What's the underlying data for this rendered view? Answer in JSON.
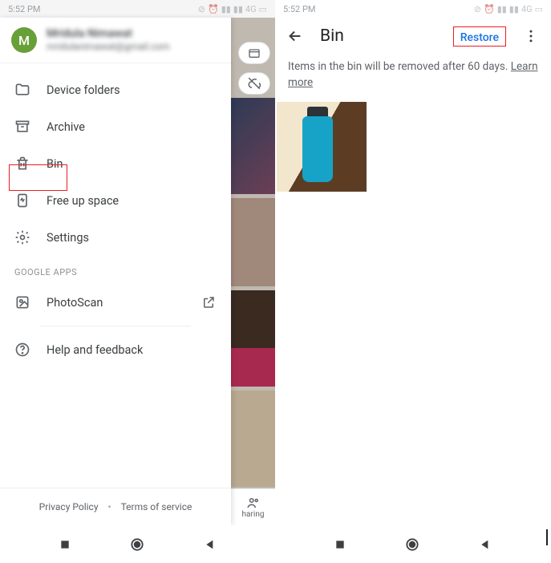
{
  "status": {
    "time": "5:52 PM",
    "net": "4G"
  },
  "account": {
    "initial": "M",
    "name": "Mridula Nimawat",
    "email": "mridulanimawat@gmail.com"
  },
  "nav": {
    "device_folders": "Device folders",
    "archive": "Archive",
    "bin": "Bin",
    "free_up_space": "Free up space",
    "settings": "Settings",
    "section_google_apps": "Google Apps",
    "photoscan": "PhotoScan",
    "help_feedback": "Help and feedback"
  },
  "footer": {
    "privacy": "Privacy Policy",
    "terms": "Terms of service"
  },
  "bg_tab": {
    "sharing": "haring"
  },
  "bin_screen": {
    "title": "Bin",
    "restore": "Restore",
    "info_text": "Items in the bin will be removed after 60 days. ",
    "learn_more": "Learn more"
  }
}
